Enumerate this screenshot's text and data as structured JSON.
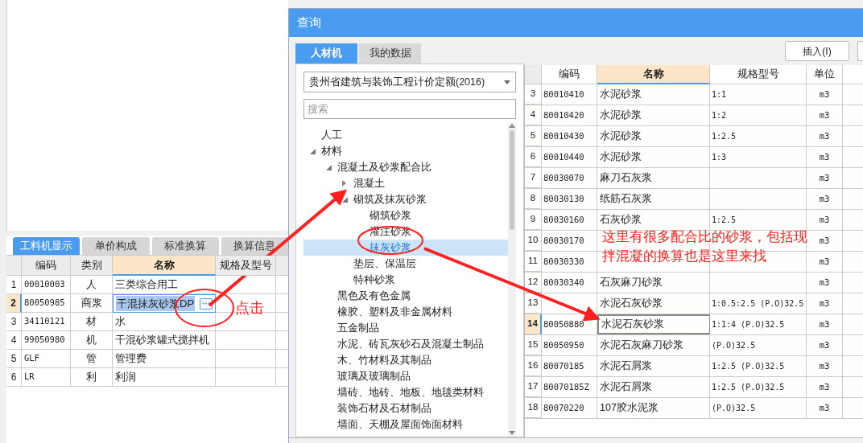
{
  "main_panel": {
    "tabs": [
      {
        "label": "工料机显示",
        "selected": true
      },
      {
        "label": "单价构成",
        "selected": false
      },
      {
        "label": "标准换算",
        "selected": false
      },
      {
        "label": "换算信息",
        "selected": false
      }
    ],
    "table": {
      "columns": [
        "编码",
        "类别",
        "名称",
        "规格及型号"
      ],
      "rows": [
        {
          "index": "1",
          "code": "00010003",
          "category": "人",
          "name": "三类综合用工",
          "selected": false
        },
        {
          "index": "2",
          "code": "80050985",
          "category": "商浆",
          "name": "干混抹灰砂浆DP",
          "selected": true
        },
        {
          "index": "3",
          "code": "34110121",
          "category": "材",
          "name": "水",
          "selected": false
        },
        {
          "index": "4",
          "code": "99050980",
          "category": "机",
          "name": "干混砂浆罐式搅拌机",
          "selected": false
        },
        {
          "index": "5",
          "code": "GLF",
          "category": "管",
          "name": "管理费",
          "selected": false
        },
        {
          "index": "6",
          "code": "LR",
          "category": "利",
          "name": "利润",
          "selected": false
        }
      ]
    }
  },
  "dialog": {
    "title": "查询",
    "tabs": [
      {
        "label": "人材机",
        "selected": true
      },
      {
        "label": "我的数据",
        "selected": false
      }
    ],
    "library_dropdown": {
      "value": "贵州省建筑与装饰工程计价定额(2016)"
    },
    "search": {
      "placeholder": "搜索"
    },
    "tree": [
      {
        "label": "人工",
        "selected": false
      },
      {
        "label": "材料",
        "selected": false,
        "expanded": true,
        "children": [
          {
            "label": "混凝土及砂浆配合比",
            "selected": false,
            "expanded": true,
            "children": [
              {
                "label": "混凝土",
                "selected": false,
                "expanded": false
              },
              {
                "label": "砌筑及抹灰砂浆",
                "selected": false,
                "expanded": true,
                "children": [
                  {
                    "label": "砌筑砂浆",
                    "selected": false
                  },
                  {
                    "label": "灌注砂浆",
                    "selected": false
                  },
                  {
                    "label": "抹灰砂浆",
                    "selected": true
                  }
                ]
              },
              {
                "label": "垫层、保温层",
                "selected": false
              },
              {
                "label": "特种砂浆",
                "selected": false
              }
            ]
          },
          {
            "label": "黑色及有色金属",
            "selected": false
          },
          {
            "label": "橡胶、塑料及非金属材料",
            "selected": false
          },
          {
            "label": "五金制品",
            "selected": false
          },
          {
            "label": "水泥、砖瓦灰砂石及混凝土制品",
            "selected": false
          },
          {
            "label": "木、竹材料及其制品",
            "selected": false
          },
          {
            "label": "玻璃及玻璃制品",
            "selected": false
          },
          {
            "label": "墙砖、地砖、地板、地毯类材料",
            "selected": false
          },
          {
            "label": "装饰石材及石材制品",
            "selected": false
          },
          {
            "label": "墙面、天棚及屋面饰面材料",
            "selected": false
          }
        ]
      }
    ],
    "toolbar_buttons": [
      "插入(I)"
    ],
    "table": {
      "columns": [
        "编码",
        "名称",
        "规格型号",
        "单位"
      ],
      "rows": [
        {
          "index": "3",
          "code": "80010410",
          "name": "水泥砂浆",
          "spec": "1:1",
          "unit": "m3",
          "selected": false
        },
        {
          "index": "4",
          "code": "80010420",
          "name": "水泥砂浆",
          "spec": "1:2",
          "unit": "m3",
          "selected": false
        },
        {
          "index": "5",
          "code": "80010430",
          "name": "水泥砂浆",
          "spec": "1:2.5",
          "unit": "m3",
          "selected": false
        },
        {
          "index": "6",
          "code": "80010440",
          "name": "水泥砂浆",
          "spec": "1:3",
          "unit": "m3",
          "selected": false
        },
        {
          "index": "7",
          "code": "80030070",
          "name": "麻刀石灰浆",
          "unit": "m3",
          "selected": false
        },
        {
          "index": "8",
          "code": "80030130",
          "name": "纸筋石灰浆",
          "unit": "m3",
          "selected": false
        },
        {
          "index": "9",
          "code": "80030160",
          "name": "石灰砂浆",
          "spec": "1:2.5",
          "unit": "m3",
          "selected": false
        },
        {
          "index": "10",
          "code": "80030170",
          "unit": "m3",
          "selected": false
        },
        {
          "index": "11",
          "code": "80030330",
          "unit": "m3",
          "selected": false
        },
        {
          "index": "12",
          "code": "80030340",
          "name": "石灰麻刀砂浆",
          "unit": "m3",
          "selected": false
        },
        {
          "index": "13",
          "name": "水泥石灰砂浆",
          "spec": "1:0.5:2.5 (P.O)32.5",
          "unit": "m3",
          "selected": false
        },
        {
          "index": "14",
          "code": "80050880",
          "name": "水泥石灰砂浆",
          "spec": "1:1:4 (P.O)32.5",
          "unit": "m3",
          "selected": true
        },
        {
          "index": "15",
          "code": "80050950",
          "name": "水泥石灰麻刀砂浆",
          "spec": "(P.O)32.5",
          "unit": "m3",
          "selected": false
        },
        {
          "index": "16",
          "code": "80070185",
          "name": "水泥石屑浆",
          "spec": "1:2.5 (P.O)32.5",
          "unit": "m3",
          "selected": false
        },
        {
          "index": "17",
          "code": "80070185Z",
          "name": "水泥石屑浆",
          "spec": "1:2.5 (P.O)32.5",
          "unit": "m3",
          "selected": false
        },
        {
          "index": "18",
          "code": "80070220",
          "name": "107胶水泥浆",
          "spec": "(P.O)32.5",
          "unit": "m3",
          "selected": false
        }
      ]
    }
  },
  "annotations": {
    "click_label": "点击",
    "note_lines": [
      "这里有很多配合比的砂浆，包括现",
      "拌混凝的换算也是这里来找"
    ]
  }
}
